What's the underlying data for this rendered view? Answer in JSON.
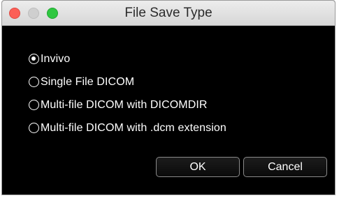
{
  "window": {
    "title": "File Save Type"
  },
  "options": [
    {
      "label": "Invivo",
      "selected": true
    },
    {
      "label": "Single File DICOM",
      "selected": false
    },
    {
      "label": "Multi-file DICOM with DICOMDIR",
      "selected": false
    },
    {
      "label": "Multi-file DICOM with .dcm extension",
      "selected": false
    }
  ],
  "buttons": {
    "ok_label": "OK",
    "cancel_label": "Cancel"
  },
  "colors": {
    "close": "#fc5f57",
    "minimize": "#cfcfcf",
    "maximize": "#2fc740",
    "dialog_background": "#000000"
  }
}
